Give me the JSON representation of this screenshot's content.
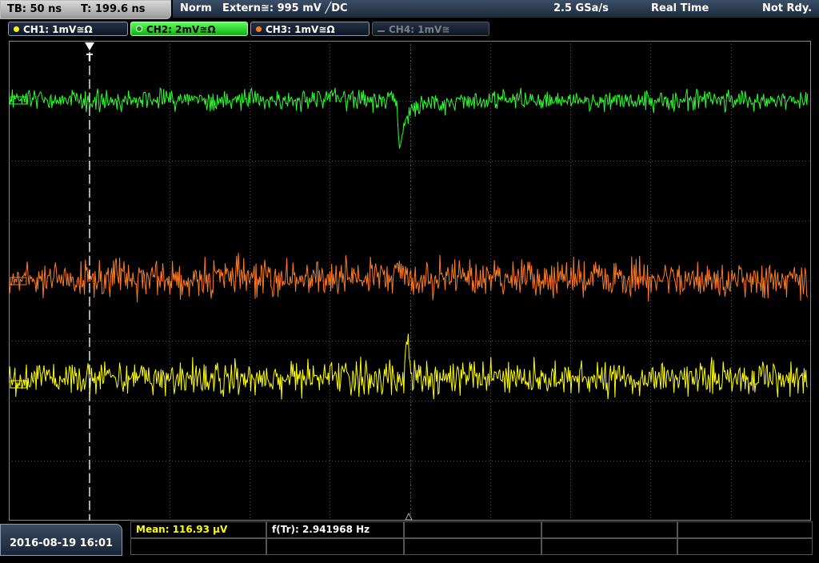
{
  "status": {
    "timebase": "TB: 50 ns",
    "trigger_time": "T: 199.6 ns",
    "trigger_mode": "Norm",
    "trigger_source": "Extern≅: 995 mV ╱DC",
    "sample_rate": "2.5 GSa/s",
    "acq_mode": "Real Time",
    "run_state": "Not Rdy."
  },
  "channels": [
    {
      "label": "CH1: 1mV≅Ω",
      "color": "#ffff00",
      "state": "on"
    },
    {
      "label": "CH2: 2mV≅Ω",
      "color": "#2bff2b",
      "state": "active"
    },
    {
      "label": "CH3: 1mV≅Ω",
      "color": "#ff7a1f",
      "state": "on"
    },
    {
      "label": "CH4: 1mV≅",
      "color": "#777777",
      "state": "off"
    }
  ],
  "markers": {
    "trigger_marker": "T"
  },
  "footer": {
    "datetime": "2016-08-19 16:01",
    "mean": "Mean: 116.93 µV",
    "freq": "f(Tr): 2.941968 Hz"
  },
  "colors": {
    "grid": "#505050",
    "ch1": "#ffff00",
    "ch2": "#2bff2b",
    "ch3": "#ff7a1f"
  }
}
